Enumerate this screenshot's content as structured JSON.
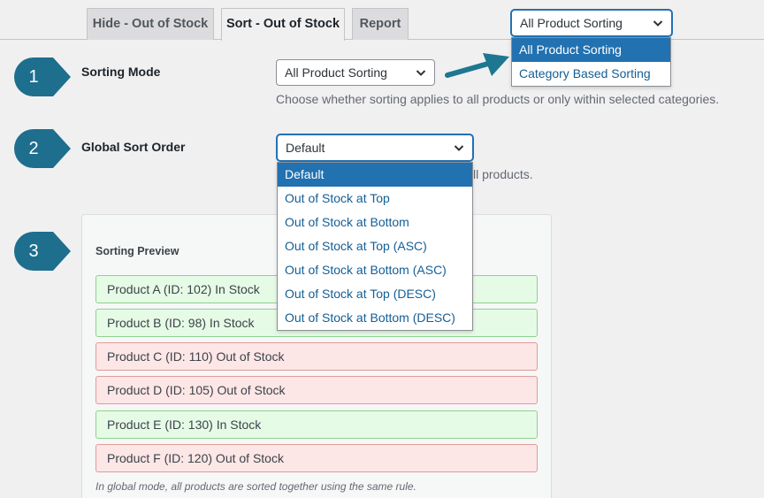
{
  "tabs": [
    {
      "label": "Hide - Out of Stock"
    },
    {
      "label": "Sort - Out of Stock"
    },
    {
      "label": "Report"
    }
  ],
  "top_select": {
    "value": "All Product Sorting",
    "options": [
      "All Product Sorting",
      "Category Based Sorting"
    ]
  },
  "sorting_mode": {
    "badge": "1",
    "label": "Sorting Mode",
    "value": "All Product Sorting",
    "description": "Choose whether sorting applies to all products or only within selected categories."
  },
  "global_sort": {
    "badge": "2",
    "label": "Global Sort Order",
    "value": "Default",
    "description_tail": "ll products.",
    "options": [
      "Default",
      "Out of Stock at Top",
      "Out of Stock at Bottom",
      "Out of Stock at Top (ASC)",
      "Out of Stock at Bottom (ASC)",
      "Out of Stock at Top (DESC)",
      "Out of Stock at Bottom (DESC)"
    ]
  },
  "preview": {
    "badge": "3",
    "title": "Sorting Preview",
    "products": [
      {
        "text": "Product A (ID: 102) In Stock",
        "status": "in"
      },
      {
        "text": "Product B (ID: 98) In Stock",
        "status": "in"
      },
      {
        "text": "Product C (ID: 110) Out of Stock",
        "status": "out"
      },
      {
        "text": "Product D (ID: 105) Out of Stock",
        "status": "out"
      },
      {
        "text": "Product E (ID: 130) In Stock",
        "status": "in"
      },
      {
        "text": "Product F (ID: 120) Out of Stock",
        "status": "out"
      }
    ],
    "note": "In global mode, all products are sorted together using the same rule."
  },
  "colors": {
    "badge": "#1e6e8e",
    "arrow": "#1e7790",
    "accent": "#2271b1",
    "in_stock_bg": "#e6fbe6",
    "out_stock_bg": "#fde6e6"
  },
  "icons": {
    "select_chevron": "chevron-down-icon",
    "badge_shape": "arrow-badge-icon",
    "callout_arrow": "arrow-right-icon"
  }
}
